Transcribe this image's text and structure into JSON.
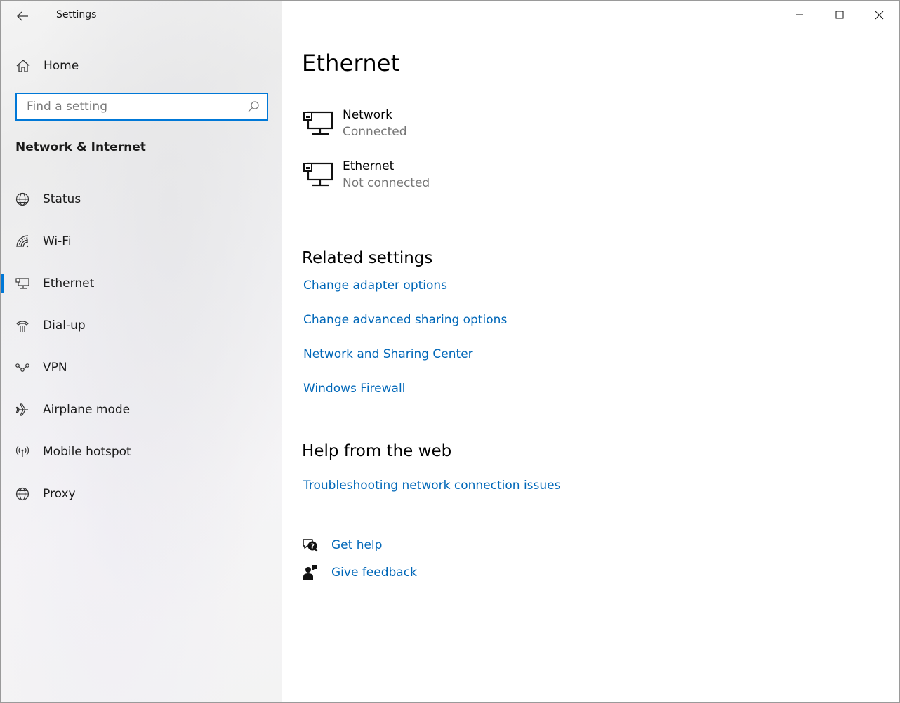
{
  "app": {
    "title": "Settings"
  },
  "window_controls": {
    "minimize_icon": "minimize-icon",
    "maximize_icon": "maximize-icon",
    "close_icon": "close-icon"
  },
  "sidebar": {
    "home_label": "Home",
    "search": {
      "placeholder": "Find a setting",
      "value": ""
    },
    "section_title": "Network & Internet",
    "items": [
      {
        "label": "Status",
        "icon": "globe-status-icon"
      },
      {
        "label": "Wi-Fi",
        "icon": "wifi-icon"
      },
      {
        "label": "Ethernet",
        "icon": "ethernet-icon",
        "active": true
      },
      {
        "label": "Dial-up",
        "icon": "dialup-icon"
      },
      {
        "label": "VPN",
        "icon": "vpn-icon"
      },
      {
        "label": "Airplane mode",
        "icon": "airplane-icon"
      },
      {
        "label": "Mobile hotspot",
        "icon": "hotspot-icon"
      },
      {
        "label": "Proxy",
        "icon": "globe-icon"
      }
    ]
  },
  "main": {
    "title": "Ethernet",
    "networks": [
      {
        "name": "Network",
        "status": "Connected"
      },
      {
        "name": "Ethernet",
        "status": "Not connected"
      }
    ],
    "related": {
      "title": "Related settings",
      "links": [
        "Change adapter options",
        "Change advanced sharing options",
        "Network and Sharing Center",
        "Windows Firewall"
      ]
    },
    "help_web": {
      "title": "Help from the web",
      "links": [
        "Troubleshooting network connection issues"
      ]
    },
    "support": {
      "get_help": "Get help",
      "give_feedback": "Give feedback"
    }
  },
  "colors": {
    "accent": "#0078d7",
    "link": "#0067b8",
    "secondary_text": "#767676"
  }
}
